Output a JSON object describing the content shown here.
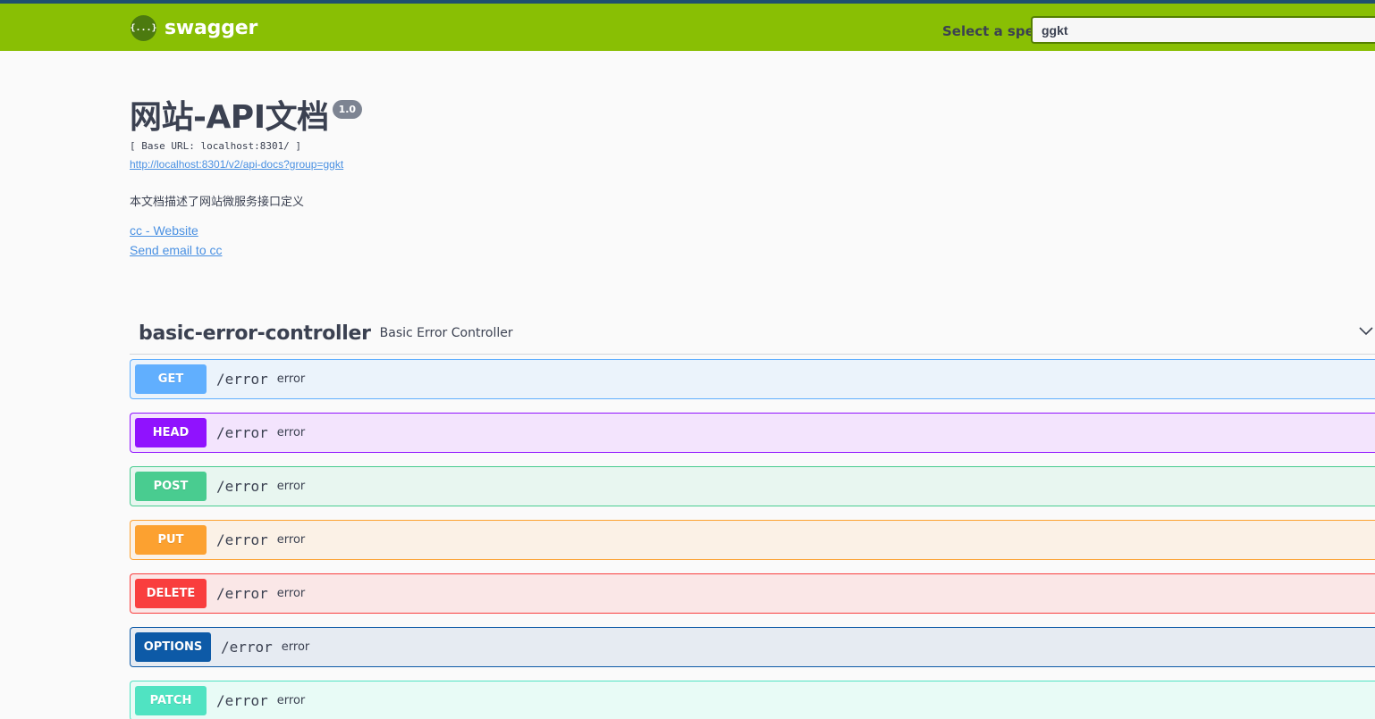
{
  "topbar": {
    "logo_symbol": "{...}",
    "logo_text": "swagger",
    "spec_label": "Select a spec",
    "spec_value": "ggkt"
  },
  "info": {
    "title": "网站-API文档",
    "version": "1.0",
    "base_url": "[ Base URL: localhost:8301/ ]",
    "doc_link": "http://localhost:8301/v2/api-docs?group=ggkt",
    "description": "本文档描述了网站微服务接口定义",
    "contact_website": "cc - Website",
    "contact_email": "Send email to cc"
  },
  "tag": {
    "name": "basic-error-controller",
    "description": "Basic Error Controller"
  },
  "operations": [
    {
      "method": "GET",
      "path": "/error",
      "summary": "error",
      "color": "#61affe",
      "bg": "#ebf3fb",
      "border": "#61affe"
    },
    {
      "method": "HEAD",
      "path": "/error",
      "summary": "error",
      "color": "#9012fe",
      "bg": "#f3e4fd",
      "border": "#9012fe"
    },
    {
      "method": "POST",
      "path": "/error",
      "summary": "error",
      "color": "#49cc90",
      "bg": "#e8f6f0",
      "border": "#49cc90"
    },
    {
      "method": "PUT",
      "path": "/error",
      "summary": "error",
      "color": "#fca130",
      "bg": "#fbf1e6",
      "border": "#fca130"
    },
    {
      "method": "DELETE",
      "path": "/error",
      "summary": "error",
      "color": "#f93e3e",
      "bg": "#fae7e7",
      "border": "#f93e3e"
    },
    {
      "method": "OPTIONS",
      "path": "/error",
      "summary": "error",
      "color": "#0d5aa7",
      "bg": "#e6ebf2",
      "border": "#0d5aa7"
    },
    {
      "method": "PATCH",
      "path": "/error",
      "summary": "error",
      "color": "#50e3c2",
      "bg": "#e8fbf6",
      "border": "#50e3c2"
    }
  ]
}
